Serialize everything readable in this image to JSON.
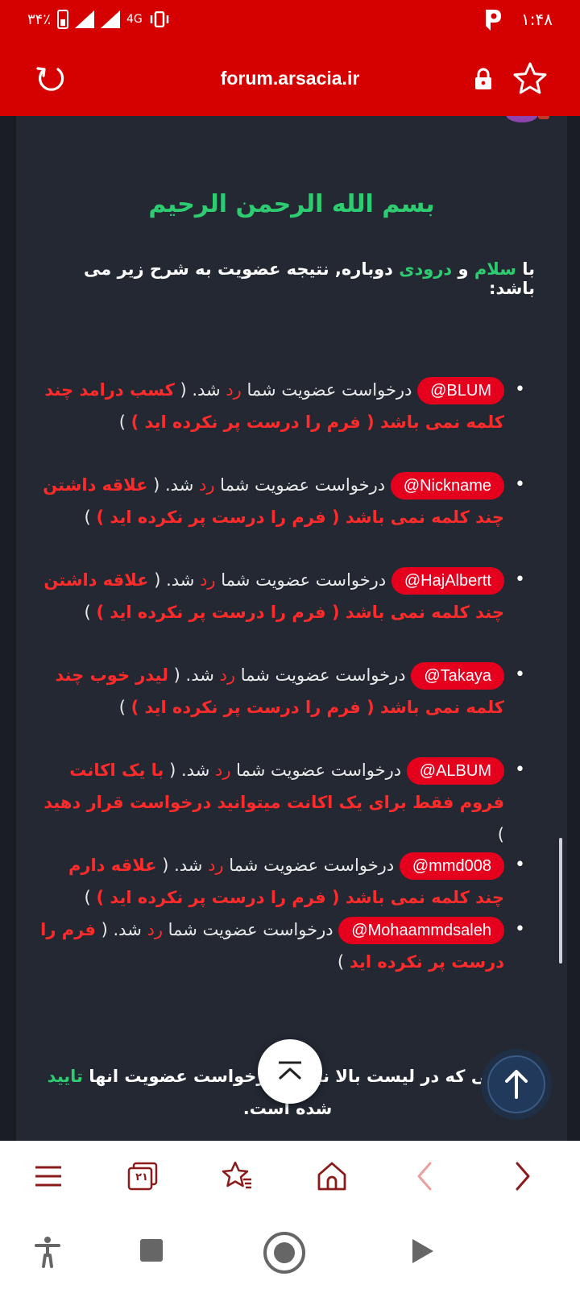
{
  "status_bar": {
    "time": "۱:۴۸",
    "battery": "۳۴٪",
    "network": "4G"
  },
  "browser": {
    "url": "forum.arsacia.ir",
    "tab_count": "۲۱"
  },
  "post": {
    "heading": "بسم الله الرحمن الرحیم",
    "intro": {
      "part1": "با",
      "salam": "سلام",
      "part2": "و",
      "doroodi": "درودی",
      "part3": "دوباره, نتیجه عضویت به شرح زیر می باشد:"
    },
    "request_text": "درخواست عضویت شما",
    "rejected_word": "رد",
    "done_word": "شد. (",
    "close_paren": ")",
    "items": [
      {
        "mention": "@BLUM",
        "reason": "کسب درامد چند کلمه نمی باشد ( فرم را درست پر نکرده اید )"
      },
      {
        "mention": "@Nickname",
        "reason": "علاقه داشتن چند کلمه نمی باشد ( فرم را درست پر نکرده اید )"
      },
      {
        "mention": "@HajAlbertt",
        "reason": "علاقه داشتن چند کلمه نمی باشد ( فرم را درست پر نکرده اید )"
      },
      {
        "mention": "@Takaya",
        "reason": "لیدر خوب چند کلمه نمی باشد ( فرم را درست پر نکرده اید )"
      },
      {
        "mention": "@ALBUM",
        "reason": "با یک اکانت فروم فقط برای یک اکانت میتوانید درخواست قرار دهید"
      },
      {
        "mention": "@mmd008",
        "reason": "علاقه دارم چند کلمه نمی باشد ( فرم را درست پر نکرده اید )"
      },
      {
        "mention": "@Mohaammdsaleh",
        "reason": "فرم را درست پر نکرده اید"
      }
    ],
    "outro": {
      "text": "کسانی که در لیست بالا نبودند درخواست عضویت انها",
      "approved": "تایید",
      "tail": "شده است."
    }
  },
  "colors": {
    "brand_red": "#d50000",
    "mention_red": "#e5001e",
    "reject_red": "#ff2b2b",
    "green": "#2ecc71",
    "content_bg": "#232833"
  }
}
